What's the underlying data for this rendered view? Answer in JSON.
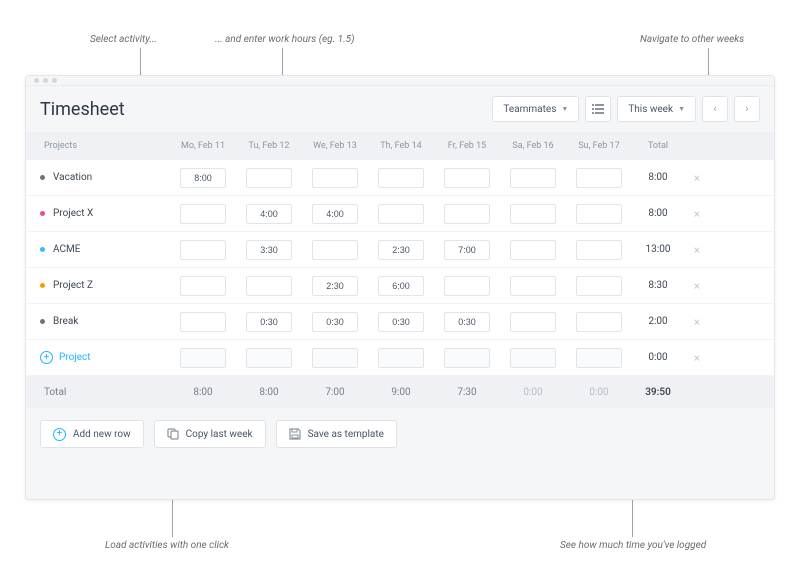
{
  "callouts": {
    "select_activity": "Select activity...",
    "enter_hours": "... and enter work hours (eg. 1.5)",
    "nav_weeks": "Navigate to other weeks",
    "load_activities": "Load activities with one click",
    "time_logged": "See how much time you've logged"
  },
  "header": {
    "title": "Timesheet",
    "teammates_label": "Teammates",
    "week_label": "This week"
  },
  "columns": {
    "projects": "Projects",
    "days": [
      "Mo, Feb 11",
      "Tu, Feb 12",
      "We, Feb 13",
      "Th, Feb 14",
      "Fr, Feb 15",
      "Sa, Feb 16",
      "Su, Feb 17"
    ],
    "total": "Total"
  },
  "rows": [
    {
      "name": "Vacation",
      "color": "#6b7280",
      "values": [
        "8:00",
        "",
        "",
        "",
        "",
        "",
        ""
      ],
      "total": "8:00"
    },
    {
      "name": "Project X",
      "color": "#ec4899",
      "values": [
        "",
        "4:00",
        "4:00",
        "",
        "",
        "",
        ""
      ],
      "total": "8:00"
    },
    {
      "name": "ACME",
      "color": "#38bdf8",
      "values": [
        "",
        "3:30",
        "",
        "2:30",
        "7:00",
        "",
        ""
      ],
      "total": "13:00"
    },
    {
      "name": "Project Z",
      "color": "#f59e0b",
      "values": [
        "",
        "",
        "2:30",
        "6:00",
        "",
        "",
        ""
      ],
      "total": "8:30"
    },
    {
      "name": "Break",
      "color": "#6b7280",
      "values": [
        "",
        "0:30",
        "0:30",
        "0:30",
        "0:30",
        "",
        ""
      ],
      "total": "2:00"
    }
  ],
  "add_project": {
    "label": "Project",
    "total": "0:00"
  },
  "totals": {
    "label": "Total",
    "days": [
      "8:00",
      "8:00",
      "7:00",
      "9:00",
      "7:30",
      "0:00",
      "0:00"
    ],
    "grand": "39:50"
  },
  "actions": {
    "add_row": "Add new row",
    "copy_last": "Copy last week",
    "save_template": "Save as template"
  }
}
